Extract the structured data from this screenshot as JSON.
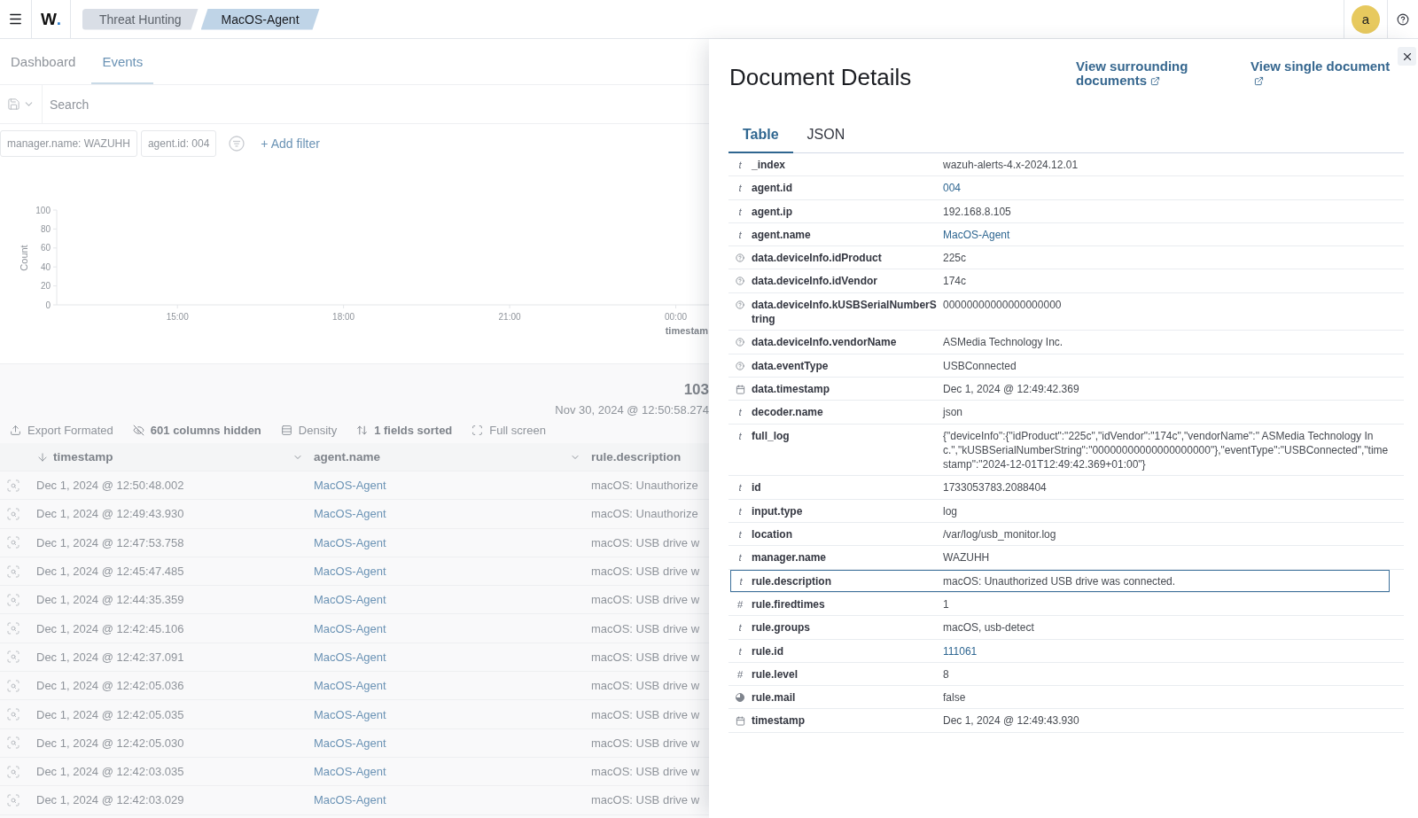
{
  "header": {
    "logo": "W.",
    "breadcrumbs": [
      {
        "label": "Threat Hunting",
        "selected": false
      },
      {
        "label": "MacOS-Agent",
        "selected": true
      }
    ],
    "avatar": "a"
  },
  "page_tabs": [
    {
      "label": "Dashboard",
      "selected": false
    },
    {
      "label": "Events",
      "selected": true
    }
  ],
  "search": {
    "placeholder": "Search"
  },
  "filters": [
    {
      "label": "manager.name: WAZUHH"
    },
    {
      "label": "agent.id: 004"
    }
  ],
  "add_filter": {
    "label": "+ Add filter"
  },
  "histogram": {
    "chart_data": {
      "type": "bar",
      "xlabel": "timestam",
      "ylabel": "Count",
      "xlim": [
        12.82,
        24.6
      ],
      "ylim": [
        0,
        100
      ],
      "xticks": [
        {
          "value": 15,
          "label": "15:00"
        },
        {
          "value": 18,
          "label": "18:00"
        },
        {
          "value": 21,
          "label": "21:00"
        },
        {
          "value": 24,
          "label": "00:00"
        }
      ],
      "yticks": [
        0,
        20,
        40,
        60,
        80,
        100
      ]
    }
  },
  "hits": {
    "count": "103",
    "time_range": "Nov 30, 2024 @ 12:50:58.274"
  },
  "toolbar": [
    {
      "label": "Export Formated",
      "kind": "export",
      "active": false
    },
    {
      "label": "601 columns hidden",
      "kind": "columns",
      "active": true
    },
    {
      "label": "Density",
      "kind": "density",
      "active": false
    },
    {
      "label": "1 fields sorted",
      "kind": "sort",
      "active": true
    },
    {
      "label": "Full screen",
      "kind": "fullscreen",
      "active": false
    }
  ],
  "events_table": {
    "columns": [
      {
        "label": "timestamp",
        "sorted": true,
        "menu": true,
        "link": false
      },
      {
        "label": "agent.name",
        "sorted": false,
        "menu": true,
        "link": true
      },
      {
        "label": "rule.description",
        "sorted": false,
        "menu": false,
        "link": false
      }
    ],
    "rows": [
      [
        "Dec 1, 2024 @ 12:50:48.002",
        "MacOS-Agent",
        "macOS: Unauthorize"
      ],
      [
        "Dec 1, 2024 @ 12:49:43.930",
        "MacOS-Agent",
        "macOS: Unauthorize"
      ],
      [
        "Dec 1, 2024 @ 12:47:53.758",
        "MacOS-Agent",
        "macOS: USB drive w"
      ],
      [
        "Dec 1, 2024 @ 12:45:47.485",
        "MacOS-Agent",
        "macOS: USB drive w"
      ],
      [
        "Dec 1, 2024 @ 12:44:35.359",
        "MacOS-Agent",
        "macOS: USB drive w"
      ],
      [
        "Dec 1, 2024 @ 12:42:45.106",
        "MacOS-Agent",
        "macOS: USB drive w"
      ],
      [
        "Dec 1, 2024 @ 12:42:37.091",
        "MacOS-Agent",
        "macOS: USB drive w"
      ],
      [
        "Dec 1, 2024 @ 12:42:05.036",
        "MacOS-Agent",
        "macOS: USB drive w"
      ],
      [
        "Dec 1, 2024 @ 12:42:05.035",
        "MacOS-Agent",
        "macOS: USB drive w"
      ],
      [
        "Dec 1, 2024 @ 12:42:05.030",
        "MacOS-Agent",
        "macOS: USB drive w"
      ],
      [
        "Dec 1, 2024 @ 12:42:03.035",
        "MacOS-Agent",
        "macOS: USB drive w"
      ],
      [
        "Dec 1, 2024 @ 12:42:03.029",
        "MacOS-Agent",
        "macOS: USB drive w"
      ]
    ]
  },
  "document_details": {
    "title": "Document Details",
    "links": [
      {
        "label": "View surrounding documents"
      },
      {
        "label": "View single document"
      }
    ],
    "tabs": [
      {
        "label": "Table",
        "selected": true
      },
      {
        "label": "JSON",
        "selected": false
      }
    ],
    "fields": [
      {
        "kind": "string",
        "glyph": "t",
        "name": "_index",
        "value": "wazuh-alerts-4.x-2024.12.01",
        "link": false,
        "selected": false
      },
      {
        "kind": "string",
        "glyph": "t",
        "name": "agent.id",
        "value": "004",
        "link": true,
        "selected": false
      },
      {
        "kind": "string",
        "glyph": "t",
        "name": "agent.ip",
        "value": "192.168.8.105",
        "link": false,
        "selected": false
      },
      {
        "kind": "string",
        "glyph": "t",
        "name": "agent.name",
        "value": "MacOS-Agent",
        "link": true,
        "selected": false
      },
      {
        "kind": "unknown",
        "name": "data.deviceInfo.idProduct",
        "value": "225c",
        "link": false,
        "selected": false
      },
      {
        "kind": "unknown",
        "name": "data.deviceInfo.idVendor",
        "value": "174c",
        "link": false,
        "selected": false
      },
      {
        "kind": "unknown",
        "name": "data.deviceInfo.kUSBSerialNumberString",
        "value": "00000000000000000000",
        "link": false,
        "selected": false
      },
      {
        "kind": "unknown",
        "name": "data.deviceInfo.vendorName",
        "value": "ASMedia Technology Inc.",
        "link": false,
        "selected": false
      },
      {
        "kind": "unknown",
        "name": "data.eventType",
        "value": "USBConnected",
        "link": false,
        "selected": false
      },
      {
        "kind": "date",
        "name": "data.timestamp",
        "value": "Dec 1, 2024 @ 12:49:42.369",
        "link": false,
        "selected": false
      },
      {
        "kind": "string",
        "glyph": "t",
        "name": "decoder.name",
        "value": "json",
        "link": false,
        "selected": false
      },
      {
        "kind": "string",
        "glyph": "t",
        "name": "full_log",
        "value": "{\"deviceInfo\":{\"idProduct\":\"225c\",\"idVendor\":\"174c\",\"vendorName\":\" ASMedia Technology Inc.\",\"kUSBSerialNumberString\":\"00000000000000000000\"},\"eventType\":\"USBConnected\",\"timestamp\":\"2024-12-01T12:49:42.369+01:00\"}",
        "link": false,
        "selected": false
      },
      {
        "kind": "string",
        "glyph": "t",
        "name": "id",
        "value": "1733053783.2088404",
        "link": false,
        "selected": false
      },
      {
        "kind": "string",
        "glyph": "t",
        "name": "input.type",
        "value": "log",
        "link": false,
        "selected": false
      },
      {
        "kind": "string",
        "glyph": "t",
        "name": "location",
        "value": "/var/log/usb_monitor.log",
        "link": false,
        "selected": false
      },
      {
        "kind": "string",
        "glyph": "t",
        "name": "manager.name",
        "value": "WAZUHH",
        "link": false,
        "selected": false
      },
      {
        "kind": "string",
        "glyph": "t",
        "name": "rule.description",
        "value": "macOS: Unauthorized USB drive was connected.",
        "link": false,
        "selected": true
      },
      {
        "kind": "number",
        "glyph": "#",
        "name": "rule.firedtimes",
        "value": "1",
        "link": false,
        "selected": false
      },
      {
        "kind": "string",
        "glyph": "t",
        "name": "rule.groups",
        "value": "macOS, usb-detect",
        "link": false,
        "selected": false
      },
      {
        "kind": "string",
        "glyph": "t",
        "name": "rule.id",
        "value": "111061",
        "link": true,
        "selected": false
      },
      {
        "kind": "number",
        "glyph": "#",
        "name": "rule.level",
        "value": "8",
        "link": false,
        "selected": false
      },
      {
        "kind": "boolean",
        "name": "rule.mail",
        "value": "false",
        "link": false,
        "selected": false
      },
      {
        "kind": "date",
        "name": "timestamp",
        "value": "Dec 1, 2024 @ 12:49:43.930",
        "link": false,
        "selected": false
      }
    ]
  }
}
